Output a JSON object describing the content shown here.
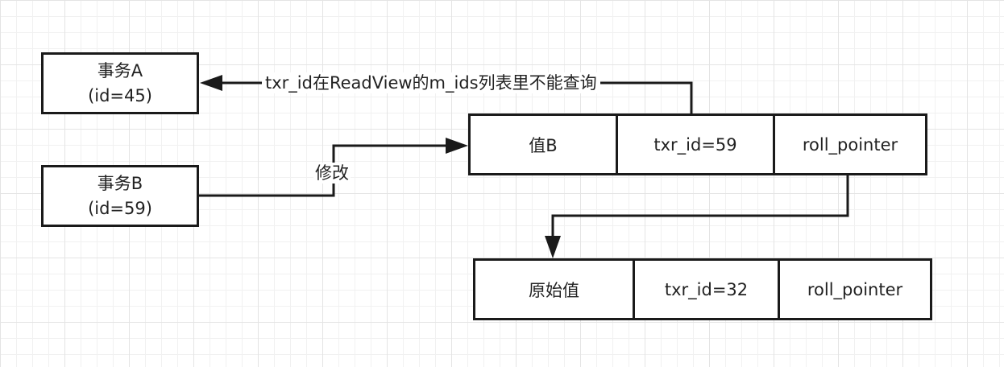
{
  "transactions": [
    {
      "name": "事务A",
      "id": "(id=45)"
    },
    {
      "name": "事务B",
      "id": "(id=59)"
    }
  ],
  "records": [
    {
      "value": "值B",
      "txr_id": "txr_id=59",
      "pointer": "roll_pointer"
    },
    {
      "value": "原始值",
      "txr_id": "txr_id=32",
      "pointer": "roll_pointer"
    }
  ],
  "edges": {
    "cannot_query": "txr_id在ReadView的m_ids列表里不能查询",
    "modify": "修改"
  }
}
